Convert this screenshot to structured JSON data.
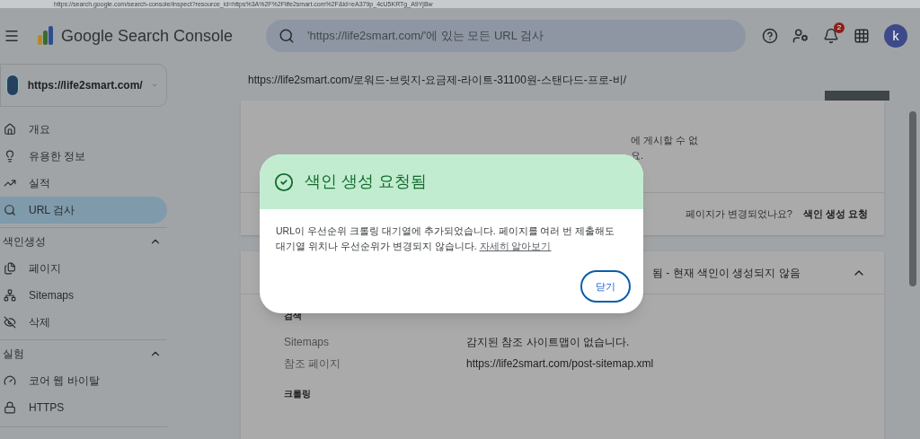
{
  "browser": {
    "address": "https://search.google.com/search-console/inspect?resource_id=https%3A%2F%2Flife2smart.com%2F&id=eA379p_4cU5KRTg_A9YjBw"
  },
  "header": {
    "product": "Google Search Console",
    "search": {
      "placeholder": "'https://life2smart.com/'에 있는 모든 URL 검사"
    },
    "notifications": "2",
    "avatar": "k"
  },
  "property": {
    "label": "https://life2smart.com/"
  },
  "inspected_url": "https://life2smart.com/로워드-브릿지-요금제-라이트-31100원-스탠다드-프로-비/",
  "sidebar": [
    {
      "kind": "item",
      "label": "개요",
      "selected": false
    },
    {
      "kind": "item",
      "label": "유용한 정보",
      "selected": false
    },
    {
      "kind": "item",
      "label": "실적",
      "selected": false
    },
    {
      "kind": "item",
      "label": "URL 검사",
      "selected": true
    },
    {
      "kind": "section",
      "label": "색인생성",
      "expanded": true
    },
    {
      "kind": "item",
      "label": "페이지",
      "selected": false
    },
    {
      "kind": "item",
      "label": "Sitemaps",
      "selected": false
    },
    {
      "kind": "item",
      "label": "삭제",
      "selected": false
    },
    {
      "kind": "section",
      "label": "실험",
      "expanded": true
    },
    {
      "kind": "item",
      "label": "코어 웹 바이탈",
      "selected": false
    },
    {
      "kind": "item",
      "label": "HTTPS",
      "selected": false
    }
  ],
  "status_card": {
    "text_lines": [
      "에 게시할 수 없",
      "요."
    ],
    "question": "페이지가 변경되었나요?",
    "action": "색인 생성 요청"
  },
  "detail_card": {
    "title": "됨 - 현재 색인이 생성되지 않음",
    "expanded": true,
    "sections": [
      {
        "heading": "검색",
        "rows": [
          {
            "label": "Sitemaps",
            "value": "감지된 참조 사이트맵이 없습니다."
          },
          {
            "label": "참조 페이지",
            "value": "https://life2smart.com/post-sitemap.xml"
          }
        ]
      },
      {
        "heading": "크롤링"
      }
    ]
  },
  "dialog": {
    "title": "색인 생성 요청됨",
    "body": "URL이 우선순위 크롤링 대기열에 추가되었습니다. 페이지를 여러 번 제출해도 대기열 위치나 우선순위가 변경되지 않습니다.",
    "link": "자세히 알아보기",
    "button": "닫기"
  }
}
